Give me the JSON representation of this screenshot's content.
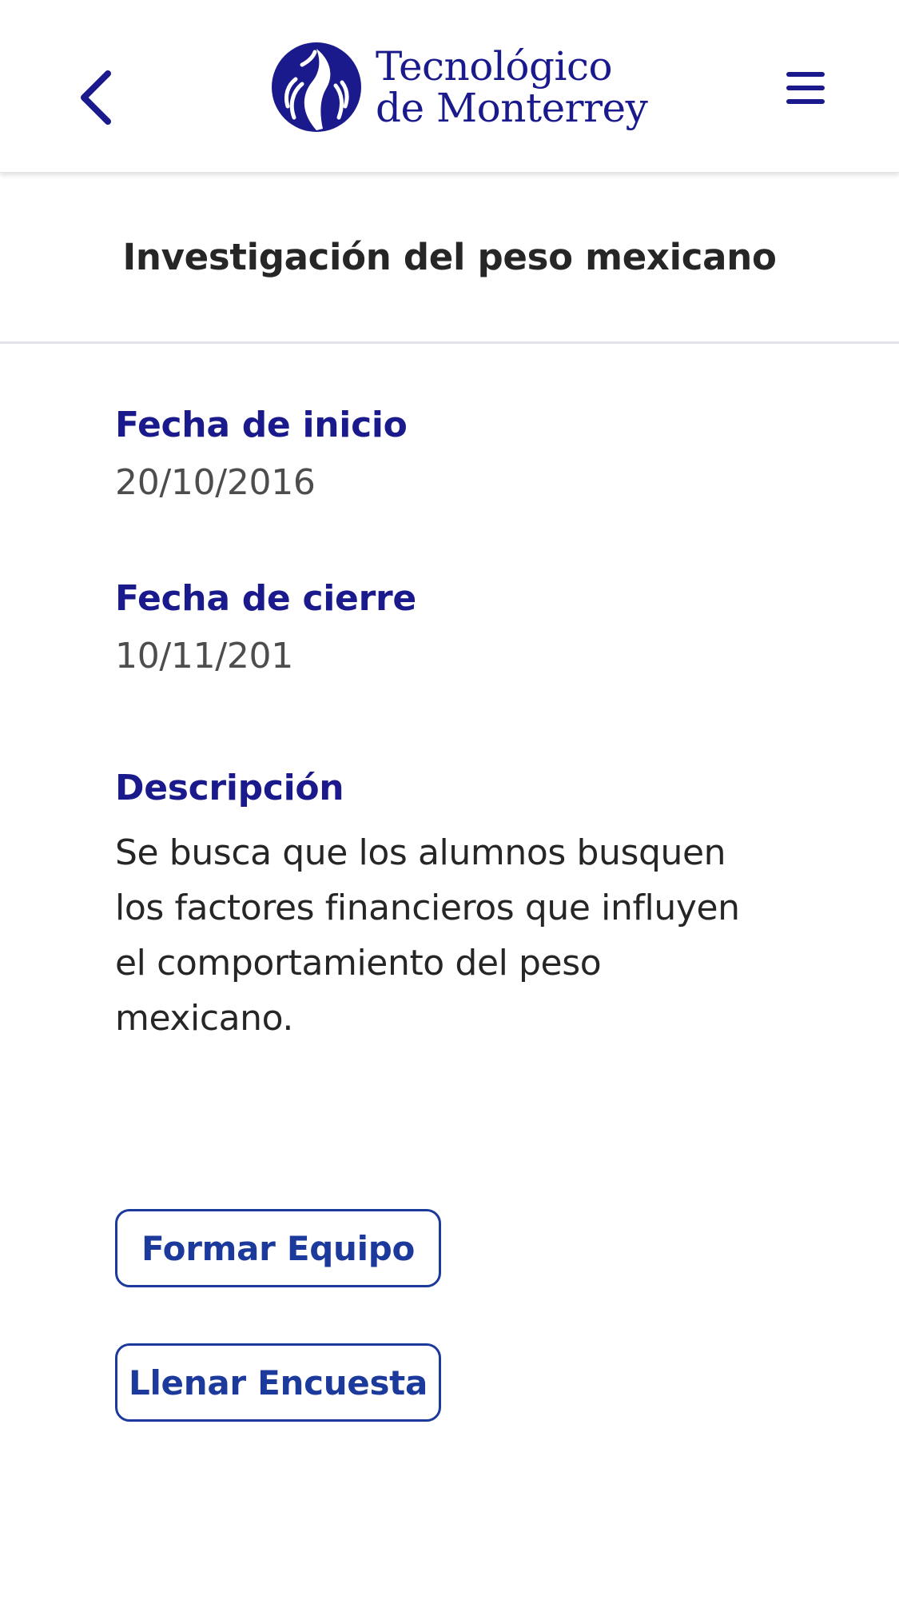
{
  "header": {
    "logo_line1": "Tecnológico",
    "logo_line2": "de Monterrey",
    "back_icon": "chevron-left-icon",
    "menu_icon": "hamburger-menu-icon",
    "accent_color": "#1a1a8c"
  },
  "project": {
    "title": "Investigación del peso mexicano",
    "start_date_label": "Fecha de inicio",
    "start_date": "20/10/2016",
    "end_date_label": "Fecha de cierre",
    "end_date": "10/11/201",
    "description_label": "Descripción",
    "description": "Se busca que los alumnos busquen los factores financieros que influyen el comportamiento del peso mexicano."
  },
  "actions": {
    "form_team_label": "Formar Equipo",
    "fill_survey_label": "Llenar Encuesta",
    "button_color": "#1b3a9c"
  }
}
